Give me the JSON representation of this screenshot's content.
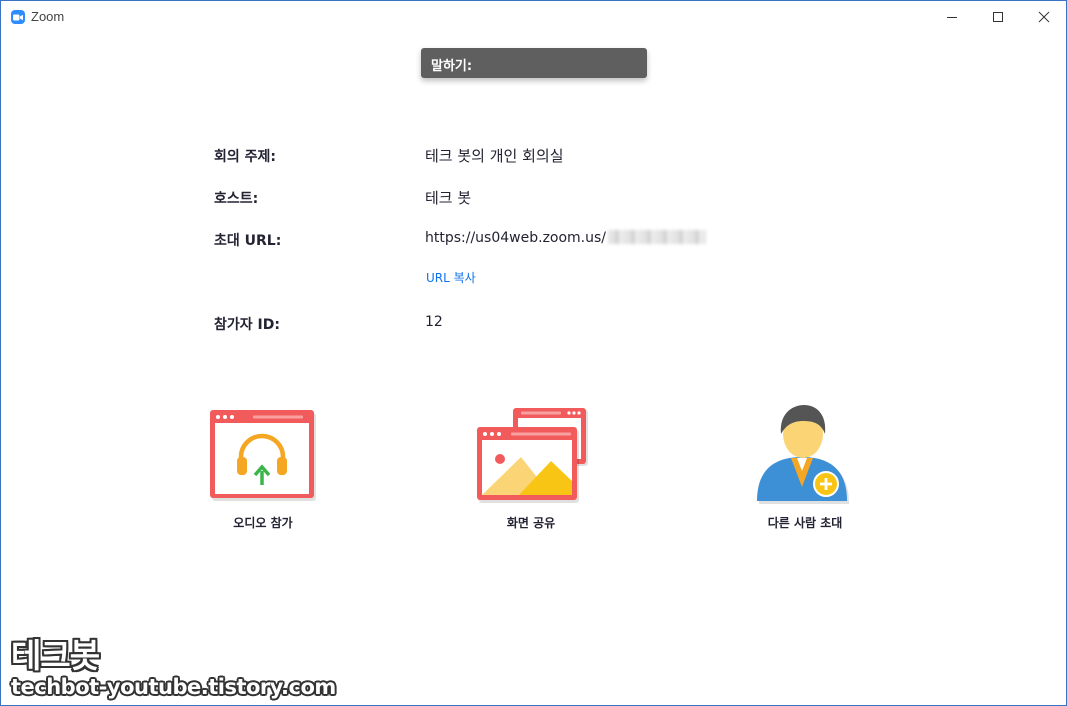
{
  "window": {
    "title": "Zoom",
    "accent": "#2d8cff",
    "icons": {
      "minimize": "minimize-icon",
      "maximize": "maximize-icon",
      "close": "close-icon"
    }
  },
  "talking": {
    "label": "말하기:"
  },
  "meeting_info": {
    "topic_label": "회의 주제:",
    "topic_value": "테크 봇의 개인 회의실",
    "host_label": "호스트:",
    "host_value": "테크 봇",
    "url_label": "초대 URL:",
    "url_value": "https://us04web.zoom.us/",
    "copy_url_label": "URL 복사",
    "participant_id_label": "참가자 ID:",
    "participant_id_value": "12"
  },
  "actions": {
    "audio": {
      "label": "오디오 참가",
      "icon": "headphone-window-icon"
    },
    "share": {
      "label": "화면 공유",
      "icon": "screen-share-icon"
    },
    "invite": {
      "label": "다른 사람 초대",
      "icon": "add-person-icon"
    }
  },
  "watermark": {
    "brand": "테크봇",
    "site": "techbot-youtube.tistory.com"
  },
  "colors": {
    "window_red": "#f25b5b",
    "link_blue": "#0e72ed",
    "talking_bg": "#5f5f5f",
    "headphone_orange": "#f5a623",
    "arrow_green": "#39b54a"
  }
}
